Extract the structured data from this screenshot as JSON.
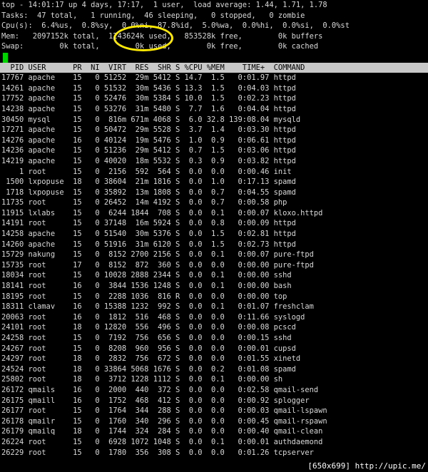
{
  "colors": {
    "background": "#000000",
    "text": "#d8d8d8",
    "header_bar_bg": "#c8c8c8",
    "header_bar_fg": "#000000",
    "cursor": "#00d400",
    "annotation": "#ffea00"
  },
  "summary": {
    "uptime_line": "top - 14:01:17 up 4 days, 17:17,  1 user,  load average: 1.44, 1.71, 1.78",
    "tasks_line": "Tasks:  47 total,   1 running,  46 sleeping,   0 stopped,   0 zombie",
    "cpu_line": "Cpu(s):  6.4%us,  0.8%sy,  0.0%ni, 87.8%id,  5.0%wa,  0.0%hi,  0.0%si,  0.0%st",
    "mem_line": "Mem:   2097152k total,  1243624k used,   853528k free,        0k buffers",
    "swap_line": "Swap:        0k total,        0k used,        0k free,        0k cached"
  },
  "table_header": "  PID USER      PR  NI  VIRT  RES  SHR S %CPU %MEM    TIME+  COMMAND",
  "processes": [
    "17767 apache    15   0 51252  29m 5412 S 14.7  1.5   0:01.97 httpd",
    "14261 apache    15   0 51532  30m 5436 S 13.3  1.5   0:04.03 httpd",
    "17752 apache    15   0 52476  30m 5384 S 10.0  1.5   0:02.23 httpd",
    "14238 apache    15   0 53276  31m 5480 S  7.7  1.6   0:04.04 httpd",
    "30450 mysql     15   0  816m 671m 4068 S  6.0 32.8 139:08.04 mysqld",
    "17271 apache    15   0 50472  29m 5528 S  3.7  1.4   0:03.30 httpd",
    "14276 apache    16   0 40124  19m 5476 S  1.0  0.9   0:06.61 httpd",
    "14236 apache    15   0 51236  29m 5412 S  0.7  1.5   0:03.06 httpd",
    "14219 apache    15   0 40020  18m 5532 S  0.3  0.9   0:03.82 httpd",
    "    1 root      15   0  2156  592  564 S  0.0  0.0   0:00.46 init",
    " 1500 lxpopuse  18   0 38604  21m 1816 S  0.0  1.0   0:17.13 spamd",
    " 1718 lxpopuse  15   0 35892  13m 1808 S  0.0  0.7   0:04.55 spamd",
    "11735 root      15   0 26452  14m 4192 S  0.0  0.7   0:00.58 php",
    "11915 lxlabs    15   0  6244 1844  708 S  0.0  0.1   0:00.07 kloxo.httpd",
    "14191 root      15   0 37148  16m 5924 S  0.0  0.8   0:00.09 httpd",
    "14258 apache    15   0 51540  30m 5376 S  0.0  1.5   0:02.81 httpd",
    "14260 apache    15   0 51916  31m 6120 S  0.0  1.5   0:02.73 httpd",
    "15729 nakung    15   0  8152 2700 2156 S  0.0  0.1   0:00.07 pure-ftpd",
    "15735 root      17   0  8152  872  360 S  0.0  0.0   0:00.00 pure-ftpd",
    "18034 root      15   0 10028 2888 2344 S  0.0  0.1   0:00.00 sshd",
    "18141 root      16   0  3844 1536 1248 S  0.0  0.1   0:00.00 bash",
    "18195 root      15   0  2288 1036  816 R  0.0  0.0   0:00.00 top",
    "18311 clamav    16   0 15388 1232  992 S  0.0  0.1   0:01.07 freshclam",
    "20063 root      16   0  1812  516  468 S  0.0  0.0   0:11.66 syslogd",
    "24101 root      18   0 12820  556  496 S  0.0  0.0   0:00.08 pcscd",
    "24258 root      15   0  7192  756  656 S  0.0  0.0   0:00.15 sshd",
    "24267 root      15   0  8208  960  956 S  0.0  0.0   0:00.01 cupsd",
    "24297 root      18   0  2832  756  672 S  0.0  0.0   0:01.55 xinetd",
    "24524 root      18   0 33864 5068 1676 S  0.0  0.2   0:01.08 spamd",
    "25802 root      18   0  3712 1228 1112 S  0.0  0.1   0:00.00 sh",
    "26172 qmails    16   0  2000  440  372 S  0.0  0.0   0:02.58 qmail-send",
    "26175 qmaill    16   0  1752  468  412 S  0.0  0.0   0:00.92 splogger",
    "26177 root      15   0  1764  344  288 S  0.0  0.0   0:00.03 qmail-lspawn",
    "26178 qmailr    15   0  1760  340  296 S  0.0  0.0   0:00.45 qmail-rspawn",
    "26179 qmailq    18   0  1744  324  284 S  0.0  0.0   0:00.40 qmail-clean",
    "26224 root      15   0  6928 1072 1048 S  0.0  0.1   0:00.01 authdaemond",
    "26229 root      15   0  1780  356  308 S  0.0  0.0   0:01.26 tcpserver"
  ],
  "watermark": "[650x699] http://upic.me/"
}
